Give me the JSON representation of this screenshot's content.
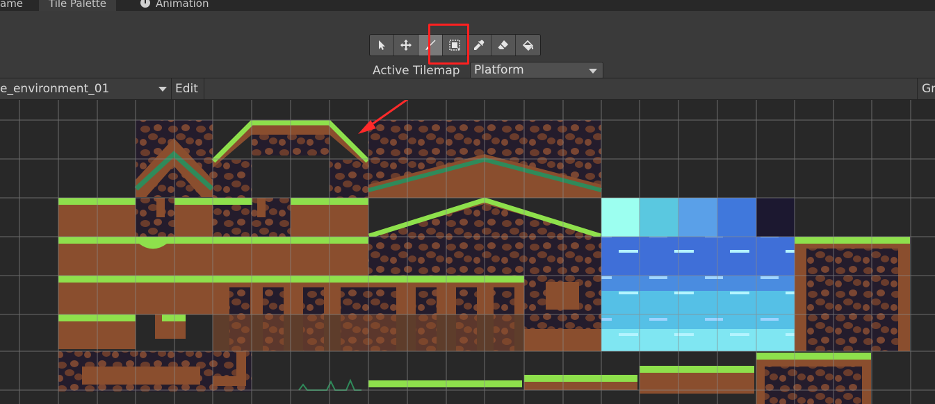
{
  "tabs": [
    {
      "label": "ame"
    },
    {
      "label": "Tile Palette"
    },
    {
      "label": "Animation"
    }
  ],
  "tools": [
    {
      "name": "select-tool",
      "icon": "arrow-pointer-icon",
      "selected": false
    },
    {
      "name": "move-tool",
      "icon": "move-arrows-icon",
      "selected": false
    },
    {
      "name": "paint-tool",
      "icon": "paintbrush-icon",
      "selected": true
    },
    {
      "name": "box-fill-tool",
      "icon": "box-fill-icon",
      "selected": false
    },
    {
      "name": "picker-tool",
      "icon": "eyedropper-icon",
      "selected": false
    },
    {
      "name": "erase-tool",
      "icon": "eraser-icon",
      "selected": false
    },
    {
      "name": "fill-tool",
      "icon": "paint-bucket-icon",
      "selected": false
    }
  ],
  "active_tilemap": {
    "label": "Active Tilemap",
    "value": "Platform"
  },
  "palette": {
    "name": "e_environment_01",
    "edit_label": "Edit",
    "grid_label": "Gr"
  },
  "colors": {
    "highlight": "#ff2020",
    "annotation_arrow": "#ff2a2a",
    "grass": "#8ee04c",
    "dirt": "#8a4e2e",
    "water_deep": "#3f6fd8",
    "water_light": "#7fe6f2"
  }
}
